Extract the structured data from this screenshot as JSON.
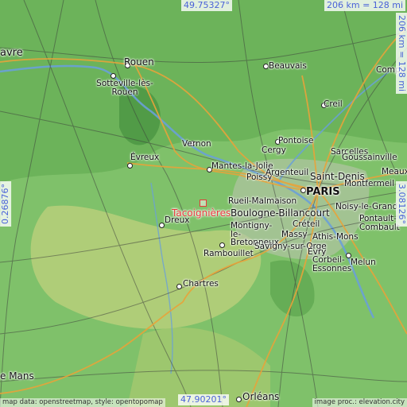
{
  "map": {
    "coords": {
      "lat_top": "49.75327°",
      "lat_bottom": "47.90201°",
      "lon_left": "0.26876°",
      "lon_right": "3.08126°"
    },
    "scale": {
      "top": "206 km = 128 mi",
      "right": "206 km = 128 mi"
    },
    "marker": "Tacoignières",
    "places": {
      "havre": "avre",
      "rouen": "Rouen",
      "sotteville": "Sotteville-lès-Rouen",
      "beauvais": "Beauvais",
      "compiegne": "Compi",
      "creil": "Creil",
      "pontoise": "Pontoise",
      "cergy": "Cergy",
      "vernon": "Vernon",
      "evreux": "Évreux",
      "mantes": "Mantes-la-Jolie",
      "poissy": "Poissy",
      "argenteuil": "Argenteuil",
      "sarcelles": "Sarcelles",
      "goussainville": "Goussainville",
      "saint_denis": "Saint-Denis",
      "meaux": "Meaux",
      "montfermeil": "Montfermeil",
      "paris": "PARIS",
      "rueil": "Rueil-Malmaison",
      "boulogne": "Boulogne-Billancourt",
      "noisy": "Noisy-le-Grand",
      "creteil": "Créteil",
      "pontault": "Pontault-Combault",
      "montigny": "Montigny-le-Bretonneux",
      "massy": "Massy",
      "athis": "Athis-Mons",
      "savigny": "Savigny-sur-Orge",
      "evry": "Évry",
      "dreux": "Dreux",
      "rambouillet": "Rambouillet",
      "corbeil": "Corbeil-Essonnes",
      "melun": "Melun",
      "chartres": "Chartres",
      "le_mans": "e Mans",
      "orleans": "Orléans"
    },
    "attribution_left": "map data: openstreetmap, style: opentopomap",
    "attribution_right": "image proc.: elevation.city"
  }
}
